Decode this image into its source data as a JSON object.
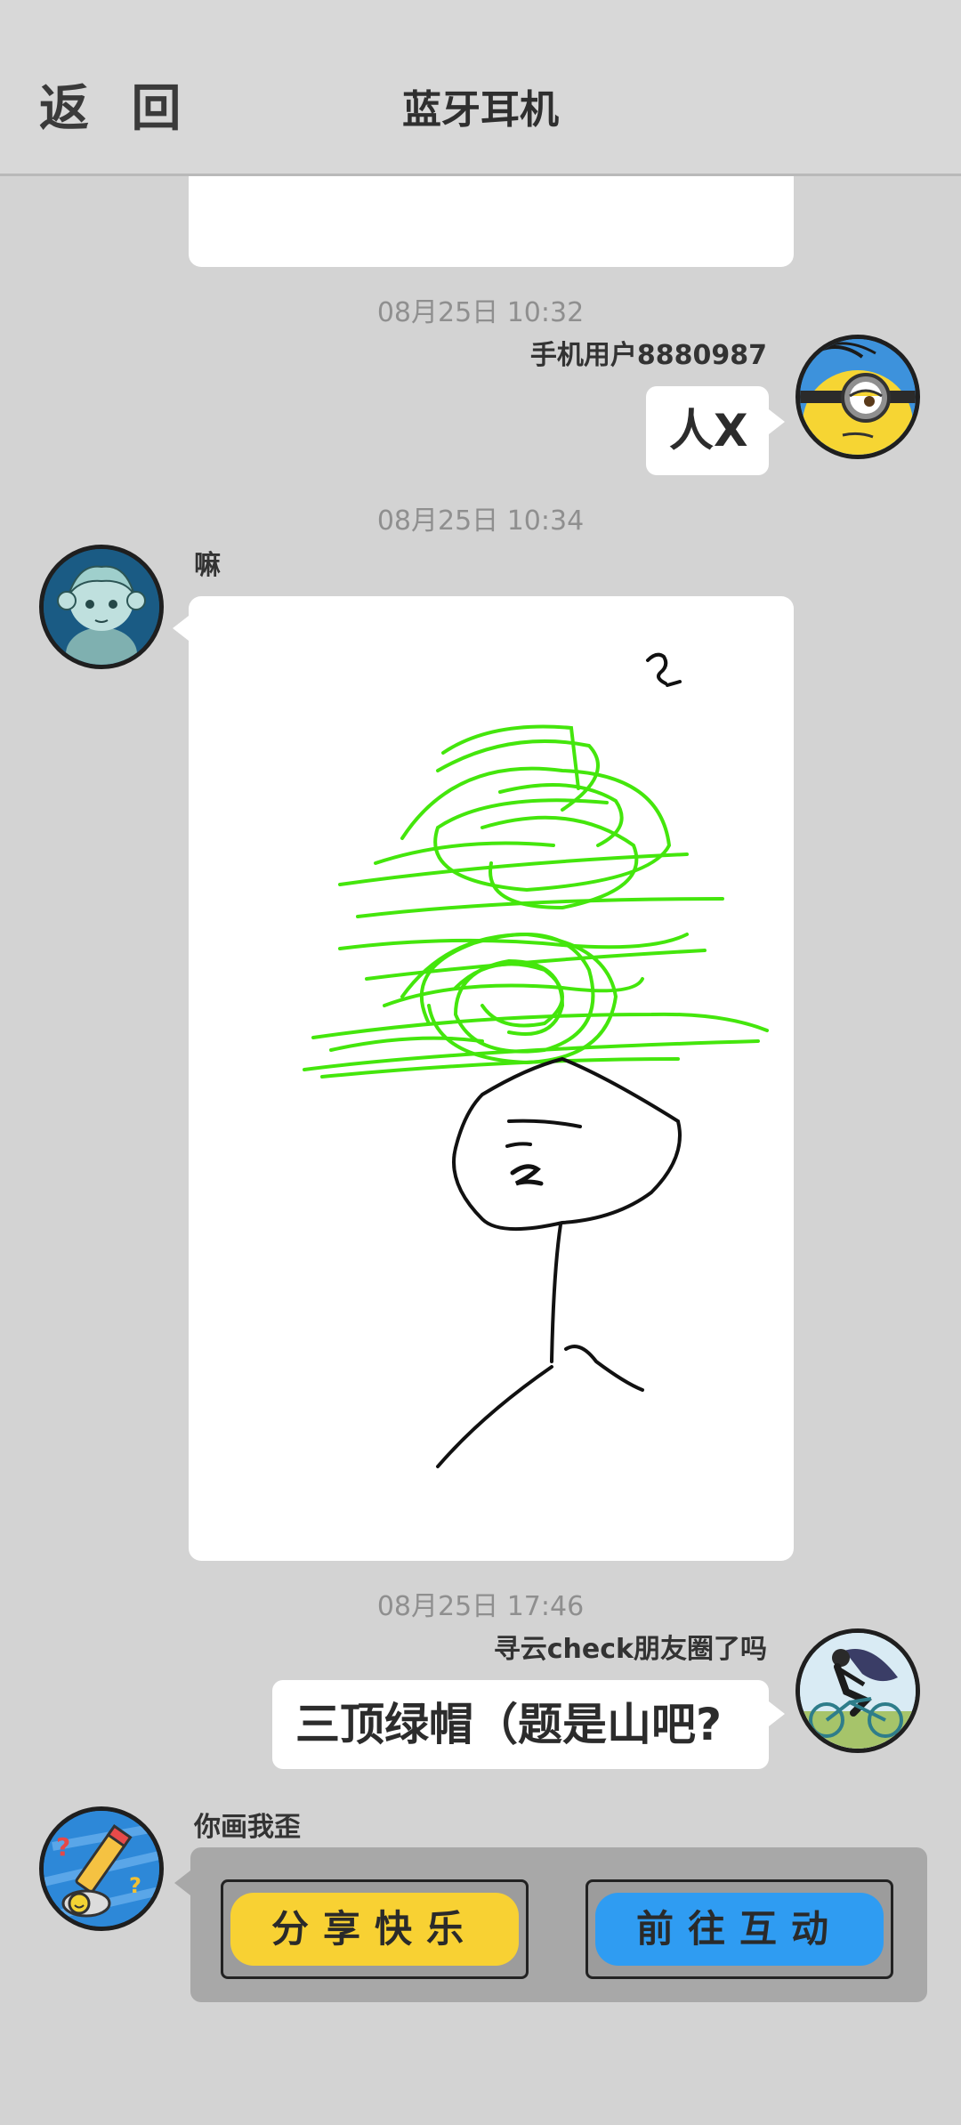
{
  "header": {
    "back_label": "返 回",
    "title": "蓝牙耳机"
  },
  "messages": [
    {
      "timestamp": "08月25日  10:32",
      "sender": "手机用户8880987",
      "text": "人X",
      "avatar": "minion-avatar-icon"
    },
    {
      "timestamp": "08月25日  10:34",
      "sender": "嘛",
      "content": "hand-drawn-sketch-image",
      "avatar": "anime-girl-avatar-icon"
    },
    {
      "timestamp": "08月25日  17:46",
      "sender": "寻云check朋友圈了吗",
      "text": "三顶绿帽（题是山吧?",
      "avatar": "cyclist-avatar-icon"
    }
  ],
  "system_card": {
    "sender": "你画我歪",
    "avatar": "pencil-draw-avatar-icon",
    "share_label": "分享快乐",
    "interact_label": "前往互动",
    "colors": {
      "share": "#f8d133",
      "interact": "#2f9cf2",
      "card_bg": "#a8a8a8"
    }
  },
  "colors": {
    "background": "#d3d3d3",
    "bubble": "#ffffff",
    "sketch_green": "#44e60c"
  }
}
